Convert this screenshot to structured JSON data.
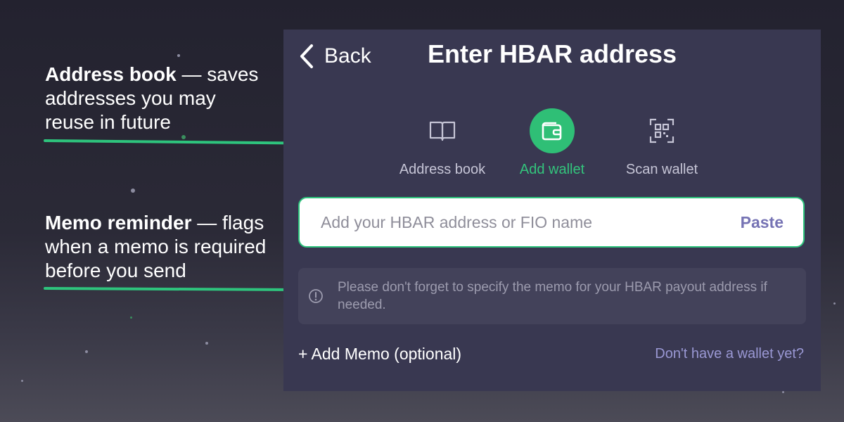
{
  "annotations": {
    "address_book": {
      "title": "Address book",
      "text": " — saves addresses you may reuse in future"
    },
    "memo_reminder": {
      "title": "Memo reminder",
      "text": " — flags when a memo is required before you send"
    }
  },
  "header": {
    "back_label": "Back",
    "title": "Enter HBAR address"
  },
  "options": [
    {
      "label": "Address book",
      "icon": "book-icon",
      "active": false
    },
    {
      "label": "Add wallet",
      "icon": "wallet-icon",
      "active": true
    },
    {
      "label": "Scan wallet",
      "icon": "qr-scan-icon",
      "active": false
    }
  ],
  "address_input": {
    "placeholder": "Add your HBAR address or FIO name",
    "value": "",
    "paste_label": "Paste"
  },
  "memo_note": {
    "icon": "info-icon",
    "text": "Please don't forget to specify the memo for your HBAR payout address if needed."
  },
  "footer": {
    "add_memo_label": "+ Add Memo (optional)",
    "no_wallet_label": "Don't have a wallet yet?"
  },
  "colors": {
    "accent": "#2fbf76",
    "panel": "#393851",
    "link": "#9a98d4",
    "paste": "#7673b4"
  }
}
